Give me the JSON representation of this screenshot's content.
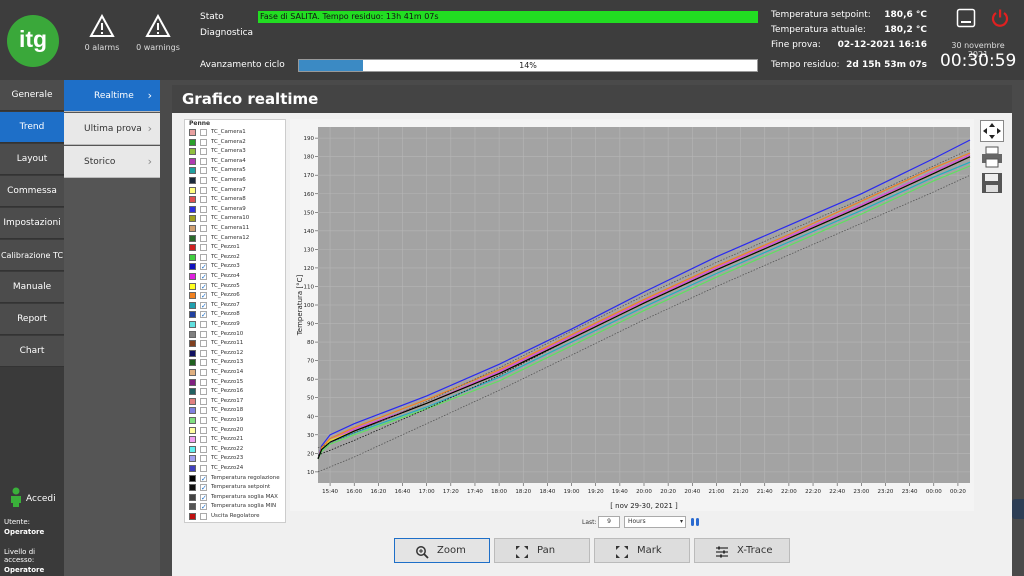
{
  "header": {
    "logo_text": "itg",
    "alarms_label": "0 alarms",
    "warnings_label": "0 warnings",
    "stato_label": "Stato",
    "stato_value": "Fase di SALITA. Tempo residuo: 13h 41m 07s",
    "diagnostica_label": "Diagnostica",
    "avanzamento_label": "Avanzamento ciclo",
    "progress_text": "14%",
    "progress_value": 0.14,
    "temp_setpoint_label": "Temperatura setpoint:",
    "temp_setpoint_value": "180,6 °C",
    "temp_attuale_label": "Temperatura attuale:",
    "temp_attuale_value": "180,2 °C",
    "fine_prova_label": "Fine prova:",
    "fine_prova_value": "02-12-2021 16:16",
    "tempo_residuo_label": "Tempo residuo:",
    "tempo_residuo_value": "2d 15h 53m 07s",
    "date": "30 novembre 2021",
    "clock": "00:30:59"
  },
  "sidebar": {
    "items": [
      {
        "label": "Generale"
      },
      {
        "label": "Trend"
      },
      {
        "label": "Layout"
      },
      {
        "label": "Commessa"
      },
      {
        "label": "Impostazioni"
      },
      {
        "label": "Calibrazione TC"
      },
      {
        "label": "Manuale"
      },
      {
        "label": "Report"
      },
      {
        "label": "Chart"
      }
    ],
    "accedi": "Accedi",
    "utente_label": "Utente:",
    "utente_value": "Operatore",
    "livello_label": "Livello di accesso:",
    "livello_value": "Operatore"
  },
  "subnav": {
    "items": [
      {
        "label": "Realtime"
      },
      {
        "label": "Ultima prova"
      },
      {
        "label": "Storico"
      }
    ]
  },
  "main": {
    "title": "Grafico realtime",
    "legend_title": "Penne",
    "legend": [
      {
        "label": "TC_Camera1",
        "color": "#e8a0a0",
        "checked": false
      },
      {
        "label": "TC_Camera2",
        "color": "#2aa02a",
        "checked": false
      },
      {
        "label": "TC_Camera3",
        "color": "#8fbf3f",
        "checked": false
      },
      {
        "label": "TC_Camera4",
        "color": "#b03ab0",
        "checked": false
      },
      {
        "label": "TC_Camera5",
        "color": "#20a0a0",
        "checked": false
      },
      {
        "label": "TC_Camera6",
        "color": "#1a2a3a",
        "checked": false
      },
      {
        "label": "TC_Camera7",
        "color": "#ffff80",
        "checked": false
      },
      {
        "label": "TC_Camera8",
        "color": "#e05050",
        "checked": false
      },
      {
        "label": "TC_Camera9",
        "color": "#3030e0",
        "checked": false
      },
      {
        "label": "TC_Camera10",
        "color": "#a0a020",
        "checked": false
      },
      {
        "label": "TC_Camera11",
        "color": "#d0a070",
        "checked": false
      },
      {
        "label": "TC_Camera12",
        "color": "#2a6a2a",
        "checked": false
      },
      {
        "label": "TC_Pezzo1",
        "color": "#d02020",
        "checked": false
      },
      {
        "label": "TC_Pezzo2",
        "color": "#40d040",
        "checked": false
      },
      {
        "label": "TC_Pezzo3",
        "color": "#1010c0",
        "checked": true
      },
      {
        "label": "TC_Pezzo4",
        "color": "#e020e0",
        "checked": true
      },
      {
        "label": "TC_Pezzo5",
        "color": "#ffff20",
        "checked": true
      },
      {
        "label": "TC_Pezzo6",
        "color": "#f08020",
        "checked": true
      },
      {
        "label": "TC_Pezzo7",
        "color": "#20a0b0",
        "checked": true
      },
      {
        "label": "TC_Pezzo8",
        "color": "#2040a0",
        "checked": true
      },
      {
        "label": "TC_Pezzo9",
        "color": "#60e0e0",
        "checked": false
      },
      {
        "label": "TC_Pezzo10",
        "color": "#808080",
        "checked": false
      },
      {
        "label": "TC_Pezzo11",
        "color": "#804020",
        "checked": false
      },
      {
        "label": "TC_Pezzo12",
        "color": "#101060",
        "checked": false
      },
      {
        "label": "TC_Pezzo13",
        "color": "#206020",
        "checked": false
      },
      {
        "label": "TC_Pezzo14",
        "color": "#e0b080",
        "checked": false
      },
      {
        "label": "TC_Pezzo15",
        "color": "#802080",
        "checked": false
      },
      {
        "label": "TC_Pezzo16",
        "color": "#206060",
        "checked": false
      },
      {
        "label": "TC_Pezzo17",
        "color": "#e08080",
        "checked": false
      },
      {
        "label": "TC_Pezzo18",
        "color": "#8080e0",
        "checked": false
      },
      {
        "label": "TC_Pezzo19",
        "color": "#80e080",
        "checked": false
      },
      {
        "label": "TC_Pezzo20",
        "color": "#ffffa0",
        "checked": false
      },
      {
        "label": "TC_Pezzo21",
        "color": "#f0a0f0",
        "checked": false
      },
      {
        "label": "TC_Pezzo22",
        "color": "#60f0f0",
        "checked": false
      },
      {
        "label": "TC_Pezzo23",
        "color": "#a0a0f0",
        "checked": false
      },
      {
        "label": "TC_Pezzo24",
        "color": "#4040c0",
        "checked": false
      },
      {
        "label": "Temperatura regolazione",
        "color": "#000000",
        "checked": true
      },
      {
        "label": "Temperatura setpoint",
        "color": "#111111",
        "checked": true
      },
      {
        "label": "Temperatura soglia MAX",
        "color": "#444444",
        "checked": true
      },
      {
        "label": "Temperatura soglia MIN",
        "color": "#555555",
        "checked": true
      },
      {
        "label": "Uscita Regolatore",
        "color": "#c01010",
        "checked": false
      }
    ],
    "last_label": "Last:",
    "last_value": "9",
    "last_unit": "Hours",
    "buttons": {
      "zoom": "Zoom",
      "pan": "Pan",
      "mark": "Mark",
      "xtrace": "X-Trace"
    }
  },
  "chart_data": {
    "type": "line",
    "ylabel": "Temperatura [°C]",
    "xlabel": "[ nov 29-30, 2021 ]",
    "ylim": [
      4,
      196
    ],
    "yticks": [
      10,
      20,
      30,
      40,
      50,
      60,
      70,
      80,
      90,
      100,
      110,
      120,
      130,
      140,
      150,
      160,
      170,
      180,
      190
    ],
    "xticks": [
      "15:40",
      "16:00",
      "16:20",
      "16:40",
      "17:00",
      "17:20",
      "17:40",
      "18:00",
      "18:20",
      "18:40",
      "19:00",
      "19:20",
      "19:40",
      "20:00",
      "20:20",
      "20:40",
      "21:00",
      "21:20",
      "21:40",
      "22:00",
      "22:20",
      "22:40",
      "23:00",
      "23:20",
      "23:40",
      "00:00",
      "00:20"
    ],
    "x_range": [
      "15:30",
      "00:30"
    ],
    "grid": true,
    "series": [
      {
        "name": "TC_Pezzo3",
        "color": "#2a2af0",
        "x": [
          "15:30",
          "15:33",
          "15:40",
          "16:00",
          "17:00",
          "18:00",
          "19:00",
          "20:00",
          "21:00",
          "22:00",
          "23:00",
          "00:00",
          "00:30"
        ],
        "y": [
          17,
          24,
          30,
          36,
          51,
          68,
          87,
          107,
          126,
          143,
          160,
          179,
          189
        ]
      },
      {
        "name": "TC_Pezzo4",
        "color": "#e040e0",
        "x": [
          "15:30",
          "15:33",
          "15:40",
          "16:00",
          "17:00",
          "18:00",
          "19:00",
          "20:00",
          "21:00",
          "22:00",
          "23:00",
          "00:00",
          "00:30"
        ],
        "y": [
          17,
          23,
          27,
          33,
          47,
          64,
          83,
          102,
          120,
          137,
          154,
          172,
          181
        ]
      },
      {
        "name": "TC_Pezzo5",
        "color": "#e8e820",
        "x": [
          "15:30",
          "15:33",
          "15:40",
          "16:00",
          "17:00",
          "18:00",
          "19:00",
          "20:00",
          "21:00",
          "22:00",
          "23:00",
          "00:00",
          "00:30"
        ],
        "y": [
          17,
          22,
          27,
          32,
          47,
          63,
          82,
          101,
          119,
          136,
          153,
          171,
          180
        ]
      },
      {
        "name": "TC_Pezzo6",
        "color": "#f08020",
        "x": [
          "15:30",
          "15:33",
          "15:40",
          "16:00",
          "17:00",
          "18:00",
          "19:00",
          "20:00",
          "21:00",
          "22:00",
          "23:00",
          "00:00",
          "00:30"
        ],
        "y": [
          17,
          23,
          28,
          34,
          49,
          65,
          84,
          103,
          121,
          138,
          156,
          174,
          182
        ]
      },
      {
        "name": "TC_Pezzo7",
        "color": "#20b0c0",
        "x": [
          "15:30",
          "15:33",
          "15:40",
          "16:00",
          "17:00",
          "18:00",
          "19:00",
          "20:00",
          "21:00",
          "22:00",
          "23:00",
          "00:00",
          "00:30"
        ],
        "y": [
          17,
          22,
          26,
          31,
          45,
          61,
          80,
          99,
          117,
          134,
          151,
          169,
          177
        ]
      },
      {
        "name": "TC_Pezzo8",
        "color": "#60e060",
        "x": [
          "15:30",
          "15:33",
          "15:40",
          "16:00",
          "17:00",
          "18:00",
          "19:00",
          "20:00",
          "21:00",
          "22:00",
          "23:00",
          "00:00",
          "00:30"
        ],
        "y": [
          17,
          21,
          25,
          30,
          44,
          59,
          78,
          97,
          115,
          132,
          149,
          167,
          175
        ]
      },
      {
        "name": "Temperatura regolazione",
        "color": "#000000",
        "x": [
          "15:30",
          "15:33",
          "15:40",
          "16:00",
          "17:00",
          "18:00",
          "19:00",
          "20:00",
          "21:00",
          "22:00",
          "23:00",
          "00:00",
          "00:30"
        ],
        "y": [
          17,
          22,
          26,
          32,
          47,
          63,
          82,
          101,
          119,
          136,
          153,
          171,
          180
        ]
      },
      {
        "name": "Temperatura setpoint",
        "color": "#111111",
        "dash": true,
        "x": [
          "15:30",
          "16:00",
          "17:00",
          "18:00",
          "19:00",
          "20:00",
          "21:00",
          "22:00",
          "23:00",
          "00:00",
          "00:30"
        ],
        "y": [
          19,
          27,
          44,
          62,
          82,
          101,
          119,
          136,
          153,
          171,
          180
        ]
      },
      {
        "name": "Temperatura soglia MAX",
        "color": "#555555",
        "dash": true,
        "x": [
          "15:30",
          "16:00",
          "17:00",
          "18:00",
          "19:00",
          "20:00",
          "21:00",
          "22:00",
          "23:00",
          "00:00",
          "00:30"
        ],
        "y": [
          23,
          31,
          48,
          66,
          86,
          105,
          123,
          140,
          157,
          175,
          184
        ]
      },
      {
        "name": "Temperatura soglia MIN",
        "color": "#555555",
        "dash": true,
        "x": [
          "15:30",
          "16:00",
          "17:00",
          "18:00",
          "19:00",
          "20:00",
          "21:00",
          "22:00",
          "23:00",
          "00:00",
          "00:30"
        ],
        "y": [
          10,
          18,
          36,
          54,
          73,
          92,
          110,
          127,
          144,
          161,
          170
        ]
      }
    ]
  }
}
